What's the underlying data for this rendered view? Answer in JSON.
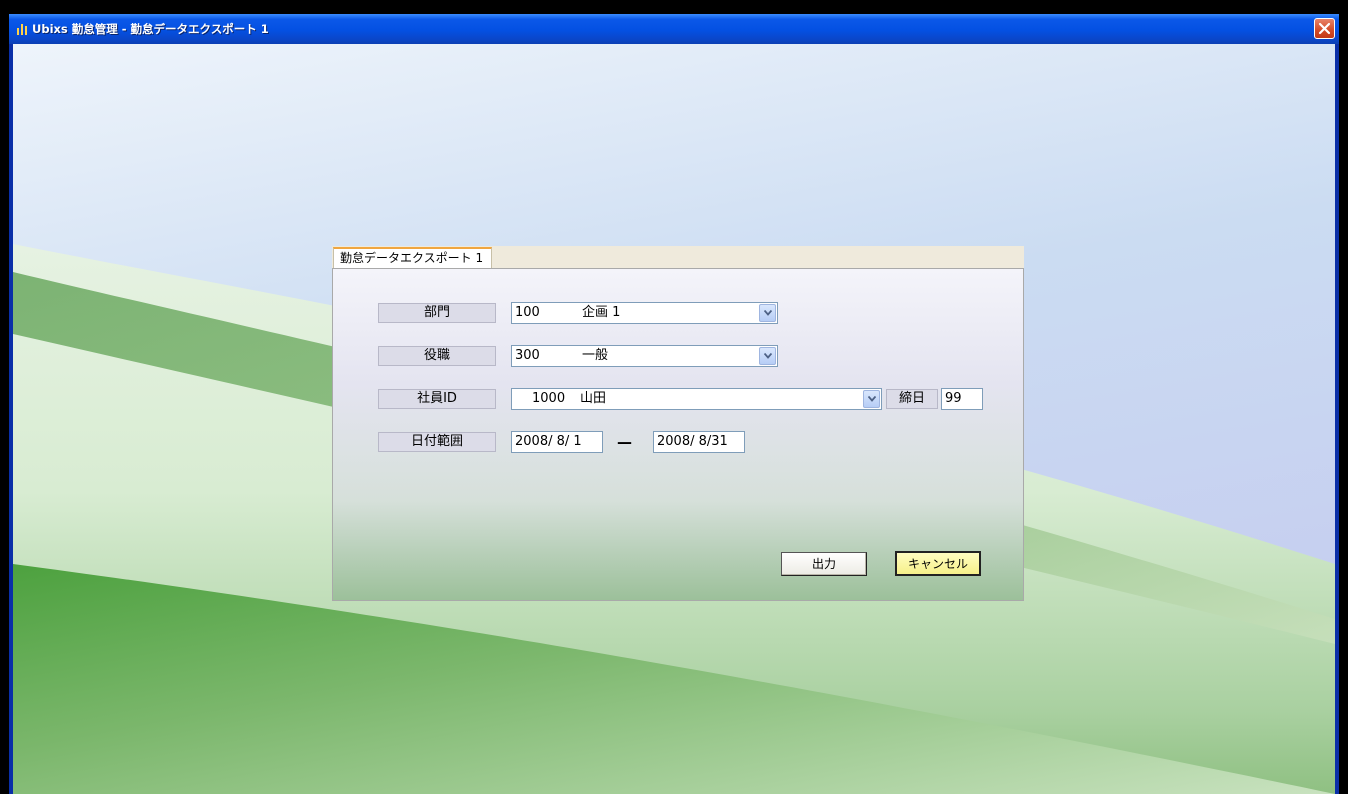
{
  "window": {
    "title": "Ubixs 勤怠管理 - 勤怠データエクスポート 1"
  },
  "tab": {
    "label": "勤怠データエクスポート 1"
  },
  "form": {
    "department": {
      "label": "部門",
      "code": "100",
      "name": "企画 1"
    },
    "position": {
      "label": "役職",
      "code": "300",
      "name": "一般"
    },
    "employee": {
      "label": "社員ID",
      "code": "1000",
      "name": "山田"
    },
    "closing_day": {
      "label": "締日",
      "value": "99"
    },
    "date_range": {
      "label": "日付範囲",
      "from": "2008/ 8/ 1",
      "separator": "—",
      "to": "2008/ 8/31"
    }
  },
  "buttons": {
    "output": "出力",
    "cancel": "キャンセル"
  },
  "colors": {
    "titlebar": "#0450e2",
    "cancel_button": "#f6f08a",
    "tab_accent": "#f0a640",
    "label_bg": "#dcdce8"
  }
}
